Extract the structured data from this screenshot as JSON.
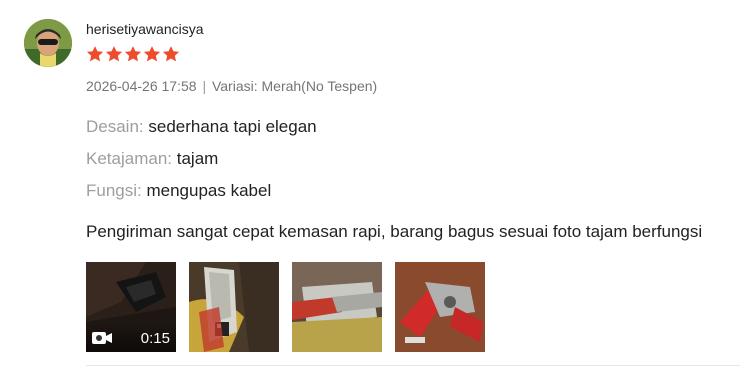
{
  "review": {
    "username": "herisetiyawancisya",
    "rating": 5,
    "star_color": "#ee4d2d",
    "date": "2026-04-26 17:58",
    "separator": "|",
    "variation": "Variasi: Merah(No Tespen)",
    "attributes": [
      {
        "key": "Desain:",
        "value": "sederhana tapi elegan"
      },
      {
        "key": "Ketajaman:",
        "value": "tajam"
      },
      {
        "key": "Fungsi:",
        "value": "mengupas kabel"
      }
    ],
    "comment": "Pengiriman sangat cepat kemasan rapi, barang bagus sesuai foto tajam berfungsi",
    "media": {
      "video": {
        "duration": "0:15",
        "icon": "video-camera-icon"
      },
      "photos": [
        "photo-1",
        "photo-2",
        "photo-3"
      ]
    }
  }
}
